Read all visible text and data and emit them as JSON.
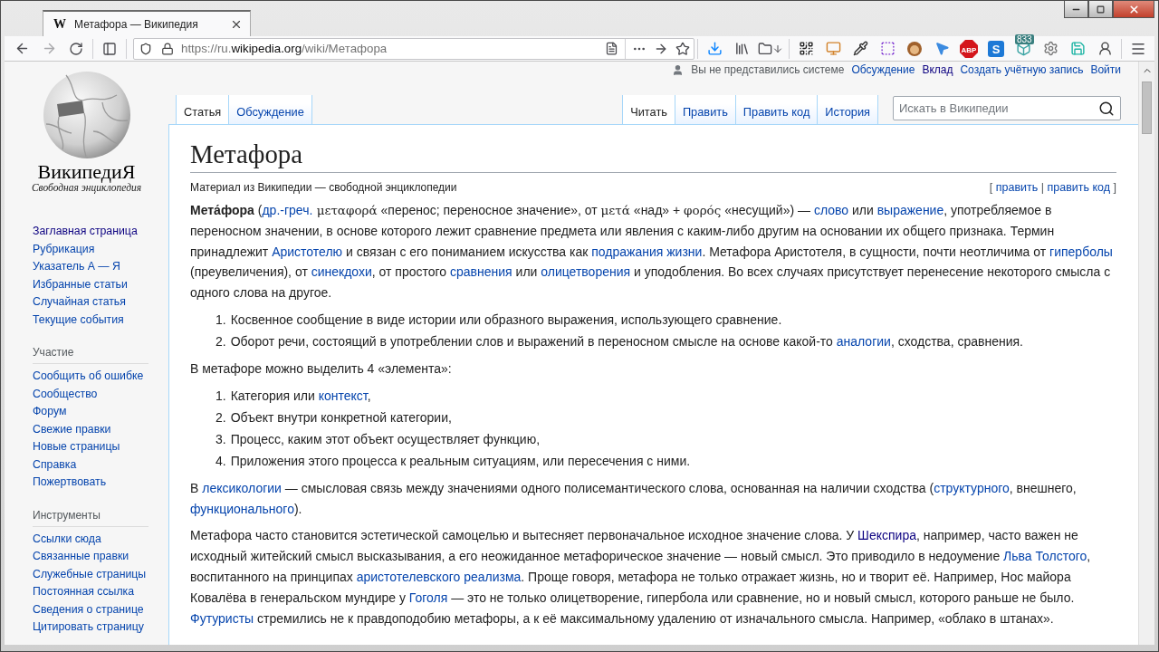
{
  "browser": {
    "tab_title": "Метафора — Википедия",
    "tab_favicon": "W",
    "url": {
      "scheme": "https://ru.",
      "host": "wikipedia.org",
      "path": "/wiki/Метафора"
    },
    "extensions": [
      {
        "kind": "qr"
      },
      {
        "kind": "monitor"
      },
      {
        "kind": "pipette"
      },
      {
        "kind": "crop"
      },
      {
        "kind": "circle"
      },
      {
        "kind": "pointer"
      },
      {
        "kind": "abp",
        "label": "ABP"
      },
      {
        "kind": "tile",
        "label": "S"
      },
      {
        "kind": "cube",
        "badge": "833"
      },
      {
        "kind": "gear"
      },
      {
        "kind": "save"
      },
      {
        "kind": "person"
      }
    ]
  },
  "personal_tools": [
    {
      "kind": "user",
      "label": "Вы не представились системе"
    },
    {
      "kind": "link",
      "label": "Обсуждение"
    },
    {
      "kind": "visited",
      "label": "Вклад"
    },
    {
      "kind": "link",
      "label": "Создать учётную запись"
    },
    {
      "kind": "link",
      "label": "Войти"
    }
  ],
  "logo": {
    "wordmark": "ВикипедиЯ",
    "tagline": "Свободная энциклопедия"
  },
  "sidebar": {
    "main": [
      {
        "label": "Заглавная страница",
        "visited": true
      },
      {
        "label": "Рубрикация",
        "visited": false
      },
      {
        "label": "Указатель А — Я",
        "visited": false
      },
      {
        "label": "Избранные статьи",
        "visited": false
      },
      {
        "label": "Случайная статья",
        "visited": false
      },
      {
        "label": "Текущие события",
        "visited": false
      }
    ],
    "sections": [
      {
        "heading": "Участие",
        "items": [
          {
            "label": "Сообщить об ошибке",
            "visited": false
          },
          {
            "label": "Сообщество",
            "visited": false
          },
          {
            "label": "Форум",
            "visited": false
          },
          {
            "label": "Свежие правки",
            "visited": false
          },
          {
            "label": "Новые страницы",
            "visited": false
          },
          {
            "label": "Справка",
            "visited": false
          },
          {
            "label": "Пожертвовать",
            "visited": false
          }
        ]
      },
      {
        "heading": "Инструменты",
        "items": [
          {
            "label": "Ссылки сюда",
            "visited": false
          },
          {
            "label": "Связанные правки",
            "visited": false
          },
          {
            "label": "Служебные страницы",
            "visited": false
          },
          {
            "label": "Постоянная ссылка",
            "visited": false
          },
          {
            "label": "Сведения о странице",
            "visited": false
          },
          {
            "label": "Цитировать страницу",
            "visited": false
          }
        ]
      }
    ]
  },
  "namespace_tabs": [
    {
      "label": "Статья",
      "selected": true
    },
    {
      "label": "Обсуждение",
      "selected": false
    }
  ],
  "view_tabs": [
    {
      "label": "Читать",
      "selected": true
    },
    {
      "label": "Править",
      "selected": false
    },
    {
      "label": "Править код",
      "selected": false
    },
    {
      "label": "История",
      "selected": false
    }
  ],
  "search": {
    "placeholder": "Искать в Википедии"
  },
  "article": {
    "title": "Метафора",
    "tagline": "Материал из Википедии — свободной энциклопедии",
    "edit_links": [
      {
        "kind": "text",
        "text": "[ "
      },
      {
        "kind": "link",
        "text": "править"
      },
      {
        "kind": "text",
        "text": " | "
      },
      {
        "kind": "link",
        "text": "править код"
      },
      {
        "kind": "text",
        "text": " ]"
      }
    ],
    "blocks": [
      {
        "kind": "paragraph",
        "segments": [
          {
            "kind": "bold",
            "text": "Мета́фора"
          },
          {
            "kind": "text",
            "text": " ("
          },
          {
            "kind": "link",
            "text": "др.-греч."
          },
          {
            "kind": "greek",
            "text": " μεταφορά"
          },
          {
            "kind": "text",
            "text": " «перенос; переносное значение», от "
          },
          {
            "kind": "greek",
            "text": "μετά"
          },
          {
            "kind": "text",
            "text": " «над» + "
          },
          {
            "kind": "greek",
            "text": "φορός"
          },
          {
            "kind": "text",
            "text": " «несущий») — "
          },
          {
            "kind": "link",
            "text": "слово"
          },
          {
            "kind": "text",
            "text": " или "
          },
          {
            "kind": "link",
            "text": "выражение"
          },
          {
            "kind": "text",
            "text": ", употребляемое в переносном значении, в основе которого лежит сравнение предмета или явления с каким-либо другим на основании их общего признака. Термин принадлежит "
          },
          {
            "kind": "link",
            "text": "Аристотелю"
          },
          {
            "kind": "text",
            "text": " и связан с его пониманием искусства как "
          },
          {
            "kind": "link",
            "text": "подражания жизни"
          },
          {
            "kind": "text",
            "text": ". Метафора Аристотеля, в сущности, почти неотличима от "
          },
          {
            "kind": "link",
            "text": "гиперболы"
          },
          {
            "kind": "text",
            "text": " (преувеличения), от "
          },
          {
            "kind": "link",
            "text": "синекдохи"
          },
          {
            "kind": "text",
            "text": ", от простого "
          },
          {
            "kind": "link",
            "text": "сравнения"
          },
          {
            "kind": "text",
            "text": " или "
          },
          {
            "kind": "link",
            "text": "олицетворения"
          },
          {
            "kind": "text",
            "text": " и уподобления. Во всех случаях присутствует перенесение некоторого смысла с одного слова на другое."
          }
        ]
      },
      {
        "kind": "list",
        "items": [
          {
            "number": "1.",
            "segments": [
              {
                "kind": "text",
                "text": "Косвенное сообщение в виде истории или образного выражения, использующего сравнение."
              }
            ]
          },
          {
            "number": "2.",
            "segments": [
              {
                "kind": "text",
                "text": "Оборот речи, состоящий в употреблении слов и выражений в переносном смысле на основе какой-то "
              },
              {
                "kind": "link",
                "text": "аналогии"
              },
              {
                "kind": "text",
                "text": ", сходства, сравнения."
              }
            ]
          }
        ]
      },
      {
        "kind": "paragraph",
        "segments": [
          {
            "kind": "text",
            "text": "В метафоре можно выделить 4 «элемента»:"
          }
        ]
      },
      {
        "kind": "list",
        "items": [
          {
            "number": "1.",
            "segments": [
              {
                "kind": "text",
                "text": "Категория или "
              },
              {
                "kind": "link",
                "text": "контекст"
              },
              {
                "kind": "text",
                "text": ","
              }
            ]
          },
          {
            "number": "2.",
            "segments": [
              {
                "kind": "text",
                "text": "Объект внутри конкретной категории,"
              }
            ]
          },
          {
            "number": "3.",
            "segments": [
              {
                "kind": "text",
                "text": "Процесс, каким этот объект осуществляет функцию,"
              }
            ]
          },
          {
            "number": "4.",
            "segments": [
              {
                "kind": "text",
                "text": "Приложения этого процесса к реальным ситуациям, или пересечения с ними."
              }
            ]
          }
        ]
      },
      {
        "kind": "paragraph",
        "segments": [
          {
            "kind": "text",
            "text": "В "
          },
          {
            "kind": "link",
            "text": "лексикологии"
          },
          {
            "kind": "text",
            "text": " — смысловая связь между значениями одного полисемантического слова, основанная на наличии сходства ("
          },
          {
            "kind": "link",
            "text": "структурного"
          },
          {
            "kind": "text",
            "text": ", внешнего, "
          },
          {
            "kind": "link",
            "text": "функционального"
          },
          {
            "kind": "text",
            "text": ")."
          }
        ]
      },
      {
        "kind": "paragraph",
        "segments": [
          {
            "kind": "text",
            "text": "Метафора часто становится эстетической самоцелью и вытесняет первоначальное исходное значение слова. У "
          },
          {
            "kind": "visited",
            "text": "Шекспира"
          },
          {
            "kind": "text",
            "text": ", например, часто важен не исходный житейский смысл высказывания, а его неожиданное метафорическое значение — новый смысл. Это приводило в недоумение "
          },
          {
            "kind": "link",
            "text": "Льва Толстого"
          },
          {
            "kind": "text",
            "text": ", воспитанного на принципах "
          },
          {
            "kind": "link",
            "text": "аристотелевского реализма"
          },
          {
            "kind": "text",
            "text": ". Проще говоря, метафора не только отражает жизнь, но и творит её. Например, Нос майора Ковалёва в генеральском мундире у "
          },
          {
            "kind": "link",
            "text": "Гоголя"
          },
          {
            "kind": "text",
            "text": " — это не только олицетворение, гипербола или сравнение, но и новый смысл, которого раньше не было. "
          },
          {
            "kind": "link",
            "text": "Футуристы"
          },
          {
            "kind": "text",
            "text": " стремились не к правдоподобию метафоры, а к её максимальному удалению от изначального смысла. Например, «облако в штанах»."
          }
        ]
      }
    ]
  }
}
